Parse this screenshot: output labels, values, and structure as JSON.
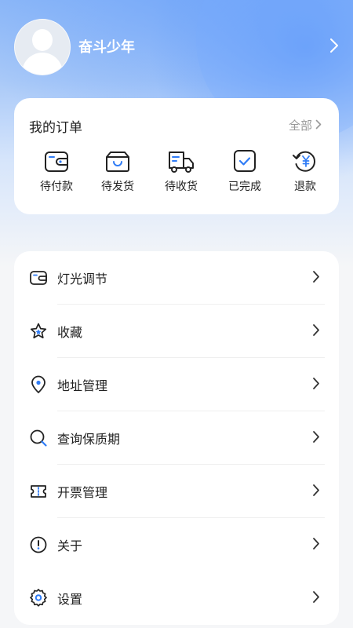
{
  "profile": {
    "username": "奋斗少年"
  },
  "orders": {
    "title": "我的订单",
    "all_label": "全部",
    "items": [
      {
        "label": "待付款",
        "icon": "wallet-icon"
      },
      {
        "label": "待发货",
        "icon": "package-icon"
      },
      {
        "label": "待收货",
        "icon": "truck-icon"
      },
      {
        "label": "已完成",
        "icon": "check-icon"
      },
      {
        "label": "退款",
        "icon": "refund-icon"
      }
    ]
  },
  "menu": {
    "items": [
      {
        "label": "灯光调节",
        "icon": "wallet-icon"
      },
      {
        "label": "收藏",
        "icon": "star-icon"
      },
      {
        "label": "地址管理",
        "icon": "location-icon"
      },
      {
        "label": "查询保质期",
        "icon": "search-icon"
      },
      {
        "label": "开票管理",
        "icon": "ticket-icon"
      },
      {
        "label": "关于",
        "icon": "info-icon"
      },
      {
        "label": "设置",
        "icon": "gear-icon"
      }
    ]
  },
  "colors": {
    "accent": "#2f7cf6",
    "icon_stroke": "#222222",
    "muted": "#999999"
  }
}
